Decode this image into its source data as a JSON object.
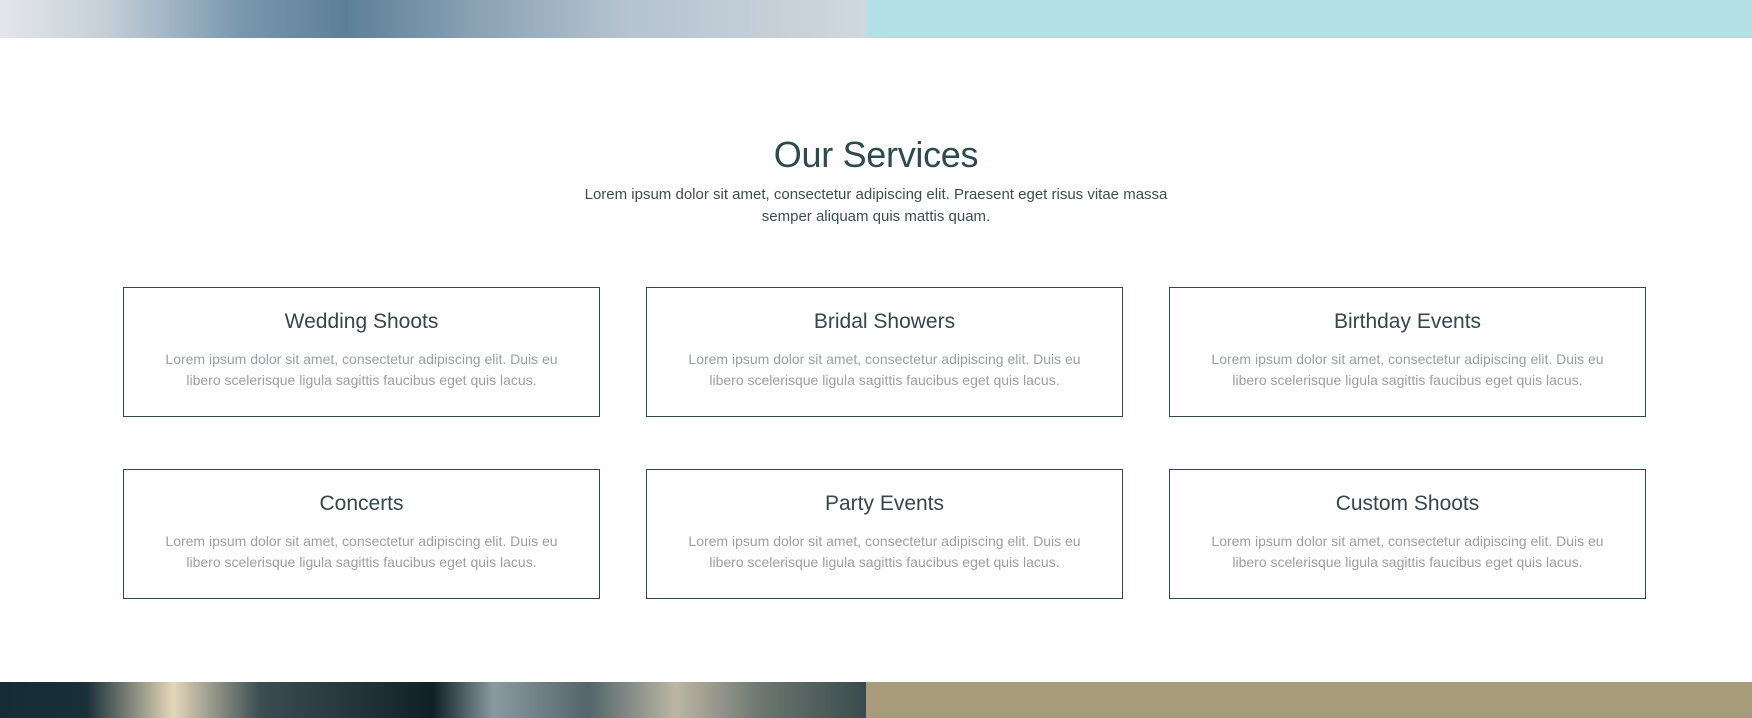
{
  "services": {
    "title": "Our Services",
    "intro": "Lorem ipsum dolor sit amet, consectetur adipiscing elit. Praesent eget risus vitae massa semper aliquam quis mattis quam.",
    "cards": [
      {
        "title": "Wedding Shoots",
        "text": "Lorem ipsum dolor sit amet, consectetur adipiscing elit. Duis eu libero scelerisque ligula sagittis faucibus eget quis lacus."
      },
      {
        "title": "Bridal Showers",
        "text": "Lorem ipsum dolor sit amet, consectetur adipiscing elit. Duis eu libero scelerisque ligula sagittis faucibus eget quis lacus."
      },
      {
        "title": "Birthday Events",
        "text": "Lorem ipsum dolor sit amet, consectetur adipiscing elit. Duis eu libero scelerisque ligula sagittis faucibus eget quis lacus."
      },
      {
        "title": "Concerts",
        "text": "Lorem ipsum dolor sit amet, consectetur adipiscing elit. Duis eu libero scelerisque ligula sagittis faucibus eget quis lacus."
      },
      {
        "title": "Party Events",
        "text": "Lorem ipsum dolor sit amet, consectetur adipiscing elit. Duis eu libero scelerisque ligula sagittis faucibus eget quis lacus."
      },
      {
        "title": "Custom Shoots",
        "text": "Lorem ipsum dolor sit amet, consectetur adipiscing elit. Duis eu libero scelerisque ligula sagittis faucibus eget quis lacus."
      }
    ]
  },
  "colors": {
    "top_panel": "#b4e0e5",
    "bottom_panel": "#a69c79",
    "heading": "#2f4a4f",
    "card_border": "#2f4a4f",
    "card_text": "#9a9fa2"
  }
}
